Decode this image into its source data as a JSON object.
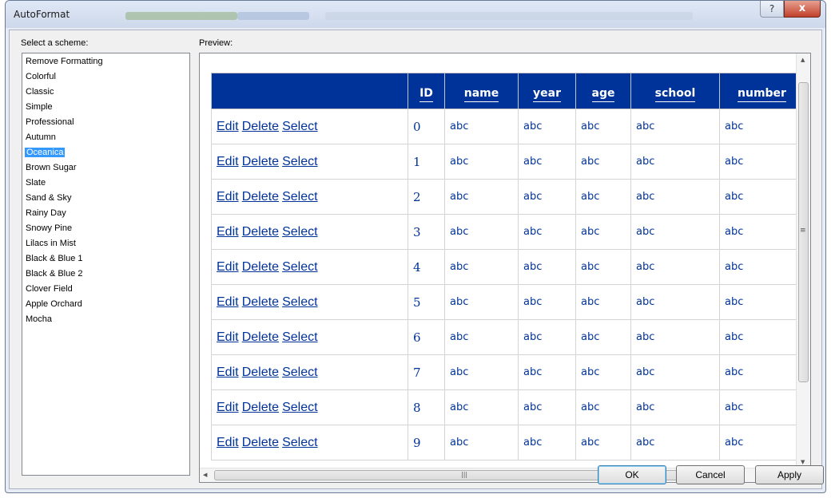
{
  "window": {
    "title": "AutoFormat",
    "help_glyph": "?",
    "close_glyph": "x"
  },
  "schemes": {
    "label": "Select a scheme:",
    "selected": "Oceanica",
    "items": [
      "Remove Formatting",
      "Colorful",
      "Classic",
      "Simple",
      "Professional",
      "Autumn",
      "Oceanica",
      "Brown Sugar",
      "Slate",
      "Sand & Sky",
      "Rainy Day",
      "Snowy Pine",
      "Lilacs in Mist",
      "Black & Blue 1",
      "Black & Blue 2",
      "Clover Field",
      "Apple Orchard",
      "Mocha"
    ]
  },
  "preview": {
    "label": "Preview:",
    "columns": [
      "",
      "ID",
      "name",
      "year",
      "age",
      "school",
      "number"
    ],
    "rows": [
      {
        "actions": [
          "Edit",
          "Delete",
          "Select"
        ],
        "id": "0",
        "name": "abc",
        "year": "abc",
        "age": "abc",
        "school": "abc",
        "number": "abc"
      },
      {
        "actions": [
          "Edit",
          "Delete",
          "Select"
        ],
        "id": "1",
        "name": "abc",
        "year": "abc",
        "age": "abc",
        "school": "abc",
        "number": "abc"
      },
      {
        "actions": [
          "Edit",
          "Delete",
          "Select"
        ],
        "id": "2",
        "name": "abc",
        "year": "abc",
        "age": "abc",
        "school": "abc",
        "number": "abc"
      },
      {
        "actions": [
          "Edit",
          "Delete",
          "Select"
        ],
        "id": "3",
        "name": "abc",
        "year": "abc",
        "age": "abc",
        "school": "abc",
        "number": "abc"
      },
      {
        "actions": [
          "Edit",
          "Delete",
          "Select"
        ],
        "id": "4",
        "name": "abc",
        "year": "abc",
        "age": "abc",
        "school": "abc",
        "number": "abc"
      },
      {
        "actions": [
          "Edit",
          "Delete",
          "Select"
        ],
        "id": "5",
        "name": "abc",
        "year": "abc",
        "age": "abc",
        "school": "abc",
        "number": "abc"
      },
      {
        "actions": [
          "Edit",
          "Delete",
          "Select"
        ],
        "id": "6",
        "name": "abc",
        "year": "abc",
        "age": "abc",
        "school": "abc",
        "number": "abc"
      },
      {
        "actions": [
          "Edit",
          "Delete",
          "Select"
        ],
        "id": "7",
        "name": "abc",
        "year": "abc",
        "age": "abc",
        "school": "abc",
        "number": "abc"
      },
      {
        "actions": [
          "Edit",
          "Delete",
          "Select"
        ],
        "id": "8",
        "name": "abc",
        "year": "abc",
        "age": "abc",
        "school": "abc",
        "number": "abc"
      },
      {
        "actions": [
          "Edit",
          "Delete",
          "Select"
        ],
        "id": "9",
        "name": "abc",
        "year": "abc",
        "age": "abc",
        "school": "abc",
        "number": "abc"
      }
    ],
    "header_color": "#003399",
    "text_color": "#003399",
    "scroll_glyphs": {
      "up": "▲",
      "down": "▼",
      "left": "◀",
      "right": "▶",
      "grip_v": "≡",
      "grip_h": "|||"
    }
  },
  "buttons": {
    "ok": "OK",
    "cancel": "Cancel",
    "apply": "Apply"
  },
  "colors": {
    "selection": "#3399ff",
    "close_button": "#c0402c"
  }
}
